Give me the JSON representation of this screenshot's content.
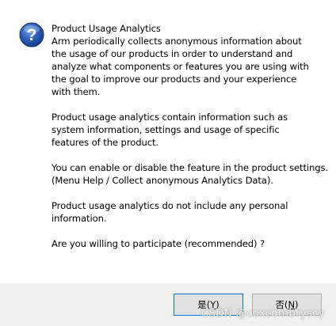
{
  "dialog": {
    "icon": "question-icon",
    "title": "Product Usage Analytics",
    "paragraphs": [
      {
        "lines": [
          "Arm periodically collects anonymous information about",
          "the usage of our products in order to understand and",
          "analyze what components or features you are using with",
          "the goal to improve our products and your experience",
          "with them."
        ]
      },
      {
        "lines": [
          "Product usage analytics contain information such as",
          "system information, settings and usage of specific",
          "features of the product."
        ]
      },
      {
        "lines": [
          "You can enable or disable the feature in the product settings.",
          "(Menu Help / Collect anonymous Analytics Data)."
        ]
      },
      {
        "lines": [
          "Product usage analytics do not include any personal",
          "information."
        ]
      },
      {
        "lines": [
          "Are you willing to participate (recommended) ?"
        ]
      }
    ]
  },
  "buttons": {
    "yes_label": "是(",
    "yes_key": "Y",
    "yes_suffix": ")",
    "no_label": "否(",
    "no_key": "N",
    "no_suffix": ")"
  },
  "watermark": "CSDN @coxcombryscy",
  "colors": {
    "icon_blue": "#1e4fa8",
    "button_bar": "#f0f0f0",
    "default_button_border": "#0078d7"
  }
}
